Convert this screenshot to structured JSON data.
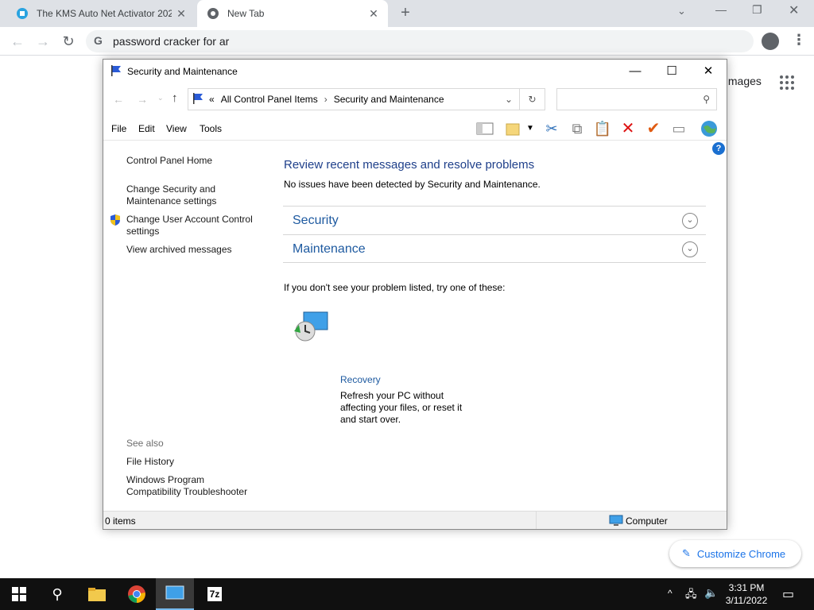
{
  "browser": {
    "tabs": [
      {
        "title": "The KMS Auto Net Activator 202",
        "active": false
      },
      {
        "title": "New Tab",
        "active": true
      }
    ],
    "new_tab": "+",
    "omnibox_value": "password cracker for ar",
    "images_link": "Images",
    "customize_label": "Customize Chrome"
  },
  "window": {
    "title": "Security and Maintenance",
    "breadcrumb": [
      "All Control Panel Items",
      "Security and Maintenance"
    ],
    "breadcrumb_overflow": "«",
    "search_placeholder": "",
    "menu": [
      "File",
      "Edit",
      "View",
      "Tools"
    ],
    "left_links": {
      "home": "Control Panel Home",
      "change_security_1": "Change Security and",
      "change_security_2": "Maintenance settings",
      "uac_1": "Change User Account Control",
      "uac_2": "settings",
      "archived": "View archived messages",
      "see_also": "See also",
      "file_history": "File History",
      "compat_1": "Windows Program",
      "compat_2": "Compatibility Troubleshooter"
    },
    "main": {
      "heading": "Review recent messages and resolve problems",
      "subtext": "No issues have been detected by Security and Maintenance.",
      "sections": [
        "Security",
        "Maintenance"
      ],
      "try_text": "If you don't see your problem listed, try one of these:",
      "recovery_title": "Recovery",
      "recovery_desc_1": "Refresh your PC without",
      "recovery_desc_2": "affecting your files, or reset it",
      "recovery_desc_3": "and start over."
    },
    "status": {
      "items": "0 items",
      "location": "Computer"
    }
  },
  "taskbar": {
    "time": "3:31 PM",
    "date": "3/11/2022",
    "sevenzip": "7z"
  }
}
